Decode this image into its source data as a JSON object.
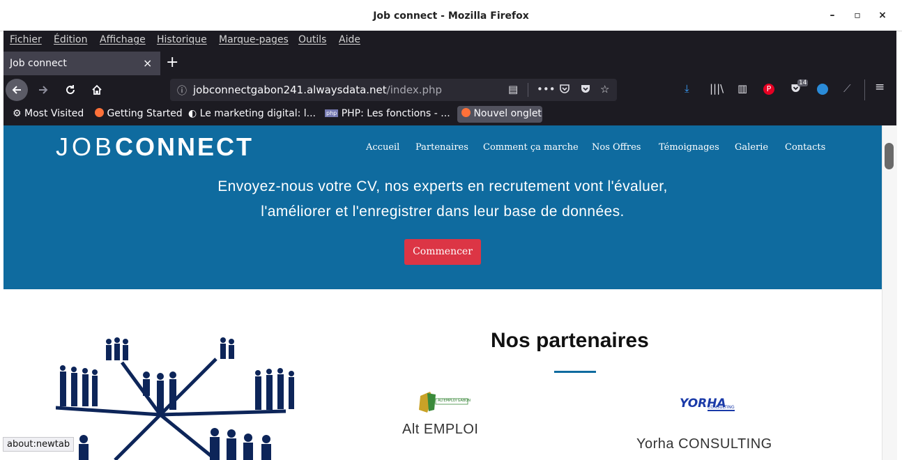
{
  "window": {
    "title": "Job connect - Mozilla Firefox",
    "minimize": "–",
    "maximize": "▫",
    "close": "×"
  },
  "menubar": [
    "Fichier",
    "Édition",
    "Affichage",
    "Historique",
    "Marque-pages",
    "Outils",
    "Aide"
  ],
  "tab": {
    "label": "Job connect",
    "close": "×",
    "new_tab": "+"
  },
  "url": {
    "domain": "jobconnectgabon241.alwaysdata.net",
    "path": "/index.php",
    "info": "ⓘ"
  },
  "toolbar": {
    "badge": "14"
  },
  "bookmarks": [
    "Most Visited",
    "Getting Started",
    "Le marketing digital: l...",
    "PHP: Les fonctions - ...",
    "Nouvel onglet"
  ],
  "site": {
    "logo_thin": "JOB",
    "logo_bold": "CONNECT",
    "nav": [
      "Accueil",
      "Partenaires",
      "Comment ça marche",
      "Nos Offres",
      "Témoignages",
      "Galerie",
      "Contacts"
    ],
    "hero_line1": "Envoyez-nous votre CV, nos experts en recrutement vont l'évaluer,",
    "hero_line2": "l'améliorer et l'enregistrer dans leur base de données.",
    "cta": "Commencer",
    "partners_title": "Nos partenaires",
    "partners": [
      {
        "name": "Alt EMPLOI",
        "logo_text": "ALTEMPLOI GABON"
      },
      {
        "name": "Yorha CONSULTING",
        "logo_text": "YORHA",
        "logo_sub": "CONSULTING"
      }
    ]
  },
  "status_text": "about:newtab",
  "colors": {
    "hero": "#0f6b9f",
    "cta": "#dc3545",
    "chrome": "#1c1b22"
  }
}
